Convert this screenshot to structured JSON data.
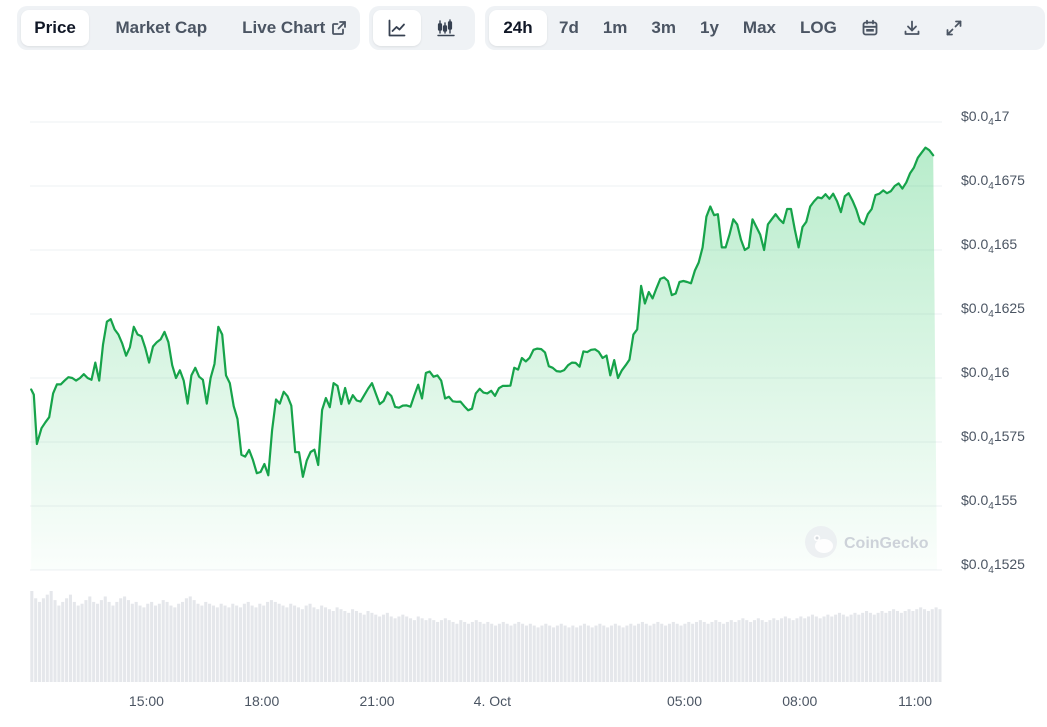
{
  "toolbar": {
    "type_tabs": {
      "price": "Price",
      "market_cap": "Market Cap",
      "live_chart": "Live Chart"
    },
    "ranges": {
      "r24h": "24h",
      "r7d": "7d",
      "r1m": "1m",
      "r3m": "3m",
      "r1y": "1y",
      "max": "Max",
      "log": "LOG"
    },
    "active_tab": "Price",
    "active_view": "line",
    "active_range": "24h",
    "icons": [
      "external-link-icon",
      "line-chart-icon",
      "candlestick-chart-icon",
      "calendar-icon",
      "download-icon",
      "expand-icon"
    ]
  },
  "watermark": "CoinGecko",
  "colors": {
    "line": "#16a34a",
    "area_fill": "#22c55e",
    "grid": "#eef0f3",
    "volume": "#e5e7eb"
  },
  "chart_data": {
    "type": "area",
    "title": "",
    "xlabel": "",
    "ylabel": "",
    "y_scale": "linear",
    "ylim": [
      1.525e-06,
      1.7e-06
    ],
    "y_ticks": [
      {
        "label_prefix": "$0.0",
        "zeros": "4",
        "digits": "17"
      },
      {
        "label_prefix": "$0.0",
        "zeros": "4",
        "digits": "1675"
      },
      {
        "label_prefix": "$0.0",
        "zeros": "4",
        "digits": "165"
      },
      {
        "label_prefix": "$0.0",
        "zeros": "4",
        "digits": "1625"
      },
      {
        "label_prefix": "$0.0",
        "zeros": "4",
        "digits": "16"
      },
      {
        "label_prefix": "$0.0",
        "zeros": "4",
        "digits": "1575"
      },
      {
        "label_prefix": "$0.0",
        "zeros": "4",
        "digits": "155"
      },
      {
        "label_prefix": "$0.0",
        "zeros": "4",
        "digits": "1525"
      }
    ],
    "y_tick_values": [
      1.7e-06,
      1.675e-06,
      1.65e-06,
      1.625e-06,
      1.6e-06,
      1.575e-06,
      1.55e-06,
      1.525e-06
    ],
    "x_ticks": [
      {
        "label": "15:00",
        "t": 3
      },
      {
        "label": "18:00",
        "t": 6
      },
      {
        "label": "21:00",
        "t": 9
      },
      {
        "label": "4. Oct",
        "t": 12
      },
      {
        "label": "05:00",
        "t": 17
      },
      {
        "label": "08:00",
        "t": 20
      },
      {
        "label": "11:00",
        "t": 23
      }
    ],
    "x_range_hours": [
      -0.03,
      23.7
    ],
    "series": [
      {
        "x_hours": [
          0,
          0.07,
          0.15,
          0.27,
          0.37,
          0.47,
          0.57,
          0.67,
          0.77,
          0.87,
          0.97,
          1.07,
          1.17,
          1.27,
          1.37,
          1.47,
          1.57,
          1.67,
          1.77,
          1.87,
          1.97,
          2.07,
          2.17,
          2.27,
          2.37,
          2.47,
          2.57,
          2.67,
          2.77,
          2.87,
          2.97,
          3.07,
          3.17,
          3.27,
          3.37,
          3.47,
          3.57,
          3.67,
          3.77,
          3.87,
          3.97,
          4.07,
          4.17,
          4.27,
          4.37,
          4.47,
          4.57,
          4.67,
          4.77,
          4.87,
          4.97,
          5.07,
          5.17,
          5.27,
          5.37,
          5.47,
          5.57,
          5.67,
          5.77,
          5.87,
          5.97,
          6.07,
          6.17,
          6.27,
          6.37,
          6.47,
          6.57,
          6.67,
          6.77,
          6.87,
          6.97,
          7.07,
          7.17,
          7.27,
          7.37,
          7.47,
          7.57,
          7.67,
          7.77,
          7.87,
          7.97,
          8.07,
          8.17,
          8.27,
          8.37,
          8.47,
          8.57,
          8.67,
          8.77,
          8.87,
          8.97,
          9.07,
          9.17,
          9.27,
          9.37,
          9.47,
          9.57,
          9.67,
          9.77,
          9.87,
          9.97,
          10.07,
          10.17,
          10.27,
          10.37,
          10.47,
          10.57,
          10.67,
          10.77,
          10.87,
          10.97,
          11.07,
          11.17,
          11.27,
          11.37,
          11.47,
          11.57,
          11.67,
          11.77,
          11.87,
          11.97,
          12.07,
          12.17,
          12.27,
          12.37,
          12.47,
          12.57,
          12.67,
          12.77,
          12.87,
          12.97,
          13.07,
          13.17,
          13.27,
          13.37,
          13.47,
          13.57,
          13.67,
          13.77,
          13.87,
          13.97,
          14.07,
          14.17,
          14.27,
          14.37,
          14.47,
          14.57,
          14.67,
          14.77,
          14.87,
          14.97,
          15.07,
          15.17,
          15.27,
          15.37,
          15.47,
          15.57,
          15.67,
          15.77,
          15.87,
          15.97,
          16.07,
          16.17,
          16.27,
          16.37,
          16.47,
          16.57,
          16.67,
          16.77,
          16.87,
          16.97,
          17.07,
          17.17,
          17.27,
          17.37,
          17.47,
          17.57,
          17.67,
          17.77,
          17.87,
          17.97,
          18.07,
          18.17,
          18.27,
          18.37,
          18.47,
          18.57,
          18.67,
          18.77,
          18.87,
          18.97,
          19.07,
          19.17,
          19.27,
          19.37,
          19.47,
          19.57,
          19.67,
          19.77,
          19.87,
          19.97,
          20.07,
          20.17,
          20.27,
          20.37,
          20.47,
          20.57,
          20.67,
          20.77,
          20.87,
          20.97,
          21.07,
          21.17,
          21.27,
          21.37,
          21.47,
          21.57,
          21.67,
          21.77,
          21.87,
          21.97,
          22.07,
          22.17,
          22.27,
          22.37,
          22.47,
          22.57,
          22.67,
          22.77,
          22.87,
          22.97,
          23.07,
          23.17,
          23.27,
          23.37,
          23.47,
          23.57
        ],
        "values": [
          1.5955e-06,
          1.5935e-06,
          1.5742e-06,
          1.5804e-06,
          1.5827e-06,
          1.5847e-06,
          1.594e-06,
          1.5975e-06,
          1.5975e-06,
          1.599e-06,
          1.6003e-06,
          1.6e-06,
          1.599e-06,
          1.6e-06,
          1.6015e-06,
          1.6e-06,
          1.5993e-06,
          1.606e-06,
          1.599e-06,
          1.613e-06,
          1.622e-06,
          1.623e-06,
          1.619e-06,
          1.617e-06,
          1.6135e-06,
          1.6087e-06,
          1.612e-06,
          1.62e-06,
          1.617e-06,
          1.6163e-06,
          1.6117e-06,
          1.606e-06,
          1.6123e-06,
          1.614e-06,
          1.6151e-06,
          1.618e-06,
          1.614e-06,
          1.605e-06,
          1.6e-06,
          1.603e-06,
          1.599e-06,
          1.59e-06,
          1.601e-06,
          1.604e-06,
          1.6005e-06,
          1.5993e-06,
          1.59e-06,
          1.6e-06,
          1.6055e-06,
          1.62e-06,
          1.617e-06,
          1.601e-06,
          1.598e-06,
          1.589e-06,
          1.584e-06,
          1.57e-06,
          1.5693e-06,
          1.5719e-06,
          1.568e-06,
          1.5628e-06,
          1.5633e-06,
          1.5664e-06,
          1.562e-06,
          1.5796e-06,
          1.5916e-06,
          1.59e-06,
          1.5946e-06,
          1.5929e-06,
          1.5892e-06,
          1.571e-06,
          1.571e-06,
          1.5614e-06,
          1.5677e-06,
          1.5711e-06,
          1.572e-06,
          1.566e-06,
          1.5875e-06,
          1.5922e-06,
          1.5886e-06,
          1.598e-06,
          1.5969e-06,
          1.5898e-06,
          1.5961e-06,
          1.59e-06,
          1.5933e-06,
          1.5912e-06,
          1.5908e-06,
          1.5934e-06,
          1.5959e-06,
          1.598e-06,
          1.5938e-06,
          1.5898e-06,
          1.591e-06,
          1.5944e-06,
          1.593e-06,
          1.5887e-06,
          1.5884e-06,
          1.5892e-06,
          1.5893e-06,
          1.5888e-06,
          1.5932e-06,
          1.5974e-06,
          1.592e-06,
          1.602e-06,
          1.6025e-06,
          1.6005e-06,
          1.601e-06,
          1.599e-06,
          1.592e-06,
          1.5927e-06,
          1.5909e-06,
          1.5907e-06,
          1.5908e-06,
          1.589e-06,
          1.5874e-06,
          1.588e-06,
          1.594e-06,
          1.5958e-06,
          1.5943e-06,
          1.594e-06,
          1.595e-06,
          1.593e-06,
          1.596e-06,
          1.5969e-06,
          1.5969e-06,
          1.597e-06,
          1.604e-06,
          1.6033e-06,
          1.6078e-06,
          1.6065e-06,
          1.6079e-06,
          1.611e-06,
          1.6115e-06,
          1.6113e-06,
          1.61e-06,
          1.6046e-06,
          1.604e-06,
          1.6027e-06,
          1.6025e-06,
          1.6031e-06,
          1.605e-06,
          1.606e-06,
          1.6059e-06,
          1.6044e-06,
          1.6104e-06,
          1.6101e-06,
          1.611e-06,
          1.6112e-06,
          1.6102e-06,
          1.6078e-06,
          1.6088e-06,
          1.601e-06,
          1.607e-06,
          1.6e-06,
          1.603e-06,
          1.605e-06,
          1.6072e-06,
          1.617e-06,
          1.619e-06,
          1.636e-06,
          1.6291e-06,
          1.6336e-06,
          1.6311e-06,
          1.635e-06,
          1.6387e-06,
          1.6393e-06,
          1.6379e-06,
          1.6324e-06,
          1.633e-06,
          1.6375e-06,
          1.6379e-06,
          1.6375e-06,
          1.637e-06,
          1.642e-06,
          1.6451e-06,
          1.651e-06,
          1.663e-06,
          1.667e-06,
          1.6636e-06,
          1.664e-06,
          1.651e-06,
          1.651e-06,
          1.656e-06,
          1.662e-06,
          1.66e-06,
          1.654e-06,
          1.65e-06,
          1.651e-06,
          1.662e-06,
          1.659e-06,
          1.656e-06,
          1.65e-06,
          1.66e-06,
          1.662e-06,
          1.664e-06,
          1.662e-06,
          1.6605e-06,
          1.666e-06,
          1.666e-06,
          1.658e-06,
          1.651e-06,
          1.659e-06,
          1.661e-06,
          1.667e-06,
          1.669e-06,
          1.6706e-06,
          1.6702e-06,
          1.6718e-06,
          1.67e-06,
          1.672e-06,
          1.669e-06,
          1.6648e-06,
          1.671e-06,
          1.6722e-06,
          1.6693e-06,
          1.6658e-06,
          1.6611e-06,
          1.66e-06,
          1.664e-06,
          1.666e-06,
          1.6715e-06,
          1.672e-06,
          1.6733e-06,
          1.6722e-06,
          1.673e-06,
          1.675e-06,
          1.676e-06,
          1.674e-06,
          1.6764e-06,
          1.68e-06,
          1.6822e-06,
          1.686e-06,
          1.688e-06,
          1.69e-06,
          1.689e-06,
          1.687e-06
        ]
      }
    ],
    "volume_bars": [
      0.5,
      0.46,
      0.44,
      0.46,
      0.48,
      0.5,
      0.45,
      0.42,
      0.44,
      0.46,
      0.48,
      0.44,
      0.42,
      0.43,
      0.45,
      0.47,
      0.44,
      0.43,
      0.45,
      0.47,
      0.44,
      0.42,
      0.44,
      0.46,
      0.47,
      0.45,
      0.43,
      0.44,
      0.42,
      0.41,
      0.43,
      0.44,
      0.42,
      0.43,
      0.45,
      0.44,
      0.42,
      0.41,
      0.43,
      0.44,
      0.46,
      0.47,
      0.45,
      0.43,
      0.42,
      0.44,
      0.43,
      0.42,
      0.41,
      0.43,
      0.42,
      0.41,
      0.43,
      0.42,
      0.41,
      0.43,
      0.44,
      0.42,
      0.41,
      0.43,
      0.42,
      0.44,
      0.45,
      0.44,
      0.43,
      0.42,
      0.41,
      0.43,
      0.42,
      0.41,
      0.4,
      0.42,
      0.43,
      0.41,
      0.4,
      0.42,
      0.41,
      0.4,
      0.39,
      0.41,
      0.4,
      0.39,
      0.38,
      0.4,
      0.39,
      0.38,
      0.37,
      0.39,
      0.38,
      0.37,
      0.36,
      0.37,
      0.38,
      0.36,
      0.35,
      0.36,
      0.37,
      0.36,
      0.35,
      0.34,
      0.36,
      0.35,
      0.34,
      0.35,
      0.34,
      0.33,
      0.34,
      0.35,
      0.34,
      0.33,
      0.32,
      0.34,
      0.33,
      0.32,
      0.33,
      0.34,
      0.33,
      0.32,
      0.33,
      0.32,
      0.31,
      0.32,
      0.33,
      0.32,
      0.31,
      0.32,
      0.33,
      0.32,
      0.31,
      0.32,
      0.31,
      0.3,
      0.31,
      0.32,
      0.31,
      0.3,
      0.31,
      0.32,
      0.31,
      0.3,
      0.31,
      0.3,
      0.31,
      0.32,
      0.31,
      0.3,
      0.31,
      0.32,
      0.31,
      0.3,
      0.31,
      0.32,
      0.31,
      0.3,
      0.31,
      0.32,
      0.31,
      0.32,
      0.33,
      0.32,
      0.31,
      0.32,
      0.33,
      0.32,
      0.31,
      0.32,
      0.33,
      0.32,
      0.31,
      0.32,
      0.33,
      0.32,
      0.33,
      0.34,
      0.33,
      0.32,
      0.33,
      0.34,
      0.33,
      0.32,
      0.33,
      0.34,
      0.33,
      0.34,
      0.35,
      0.34,
      0.33,
      0.34,
      0.35,
      0.34,
      0.33,
      0.34,
      0.35,
      0.34,
      0.35,
      0.36,
      0.35,
      0.34,
      0.35,
      0.36,
      0.35,
      0.36,
      0.37,
      0.36,
      0.35,
      0.36,
      0.37,
      0.36,
      0.37,
      0.38,
      0.37,
      0.36,
      0.37,
      0.38,
      0.37,
      0.38,
      0.39,
      0.38,
      0.37,
      0.38,
      0.39,
      0.38,
      0.39,
      0.4,
      0.39,
      0.38,
      0.39,
      0.4,
      0.39,
      0.4,
      0.41,
      0.4,
      0.39,
      0.4,
      0.41,
      0.4
    ]
  }
}
